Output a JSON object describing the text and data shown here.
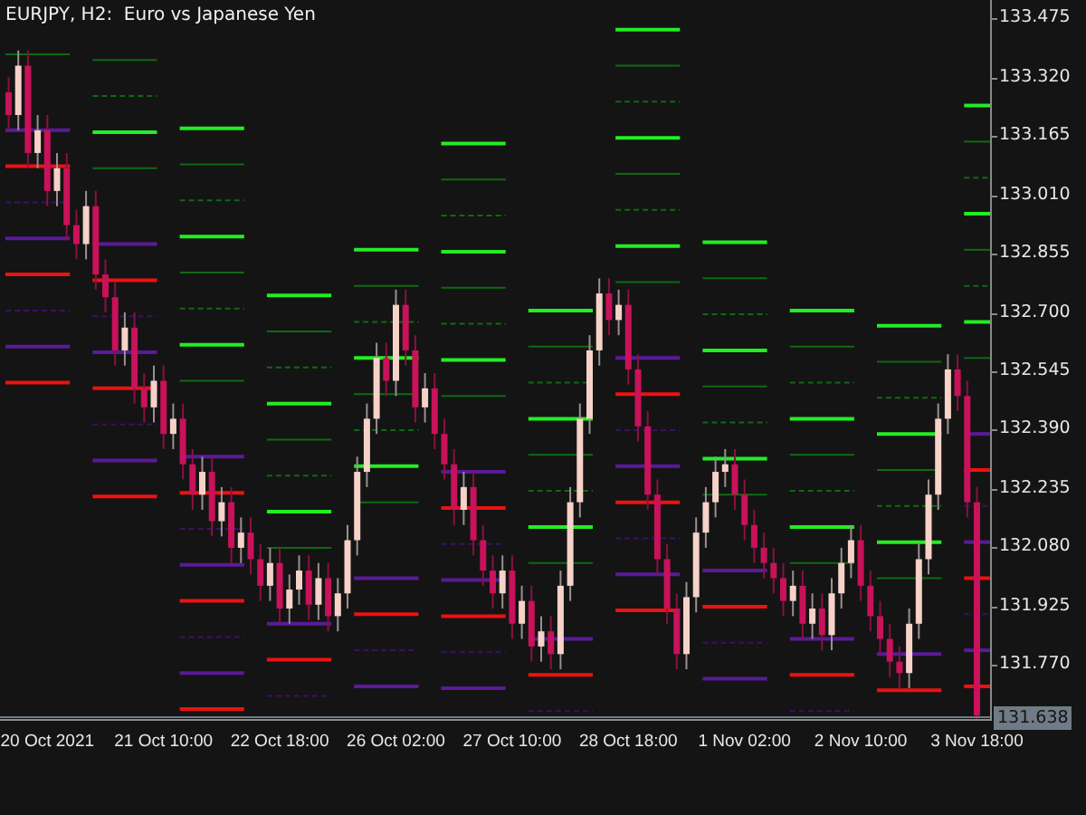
{
  "chart": {
    "title": "EURJPY, H2:  Euro vs Japanese Yen",
    "current_price": "131.638",
    "chart_data": {
      "type": "candlestick",
      "ylim": [
        131.629,
        133.523
      ],
      "yticks": [
        {
          "value": 133.475,
          "label": "133.475"
        },
        {
          "value": 133.32,
          "label": "133.320"
        },
        {
          "value": 133.165,
          "label": "133.165"
        },
        {
          "value": 133.01,
          "label": "133.010"
        },
        {
          "value": 132.855,
          "label": "132.855"
        },
        {
          "value": 132.7,
          "label": "132.700"
        },
        {
          "value": 132.545,
          "label": "132.545"
        },
        {
          "value": 132.39,
          "label": "132.390"
        },
        {
          "value": 132.235,
          "label": "132.235"
        },
        {
          "value": 132.08,
          "label": "132.080"
        },
        {
          "value": 131.925,
          "label": "131.925"
        },
        {
          "value": 131.77,
          "label": "131.770"
        }
      ],
      "categories": [
        null,
        null,
        null,
        null,
        "20 Oct 2021",
        null,
        null,
        null,
        null,
        null,
        null,
        null,
        null,
        null,
        null,
        null,
        "21 Oct 10:00",
        null,
        null,
        null,
        null,
        null,
        null,
        null,
        null,
        null,
        null,
        null,
        "22 Oct 18:00",
        null,
        null,
        null,
        null,
        null,
        null,
        null,
        null,
        null,
        null,
        null,
        "26 Oct 02:00",
        null,
        null,
        null,
        null,
        null,
        null,
        null,
        null,
        null,
        null,
        null,
        "27 Oct 10:00",
        null,
        null,
        null,
        null,
        null,
        null,
        null,
        null,
        null,
        null,
        null,
        "28 Oct 18:00",
        null,
        null,
        null,
        null,
        null,
        null,
        null,
        null,
        null,
        null,
        null,
        "1 Nov 02:00",
        null,
        null,
        null,
        null,
        null,
        null,
        null,
        null,
        null,
        null,
        null,
        "2 Nov 10:00",
        null,
        null,
        null,
        null,
        null,
        null,
        null,
        null,
        null,
        null,
        null,
        "3 Nov 18:00"
      ],
      "ohlc": [
        [
          133.28,
          133.32,
          133.18,
          133.22
        ],
        [
          133.22,
          133.39,
          133.18,
          133.35
        ],
        [
          133.35,
          133.39,
          133.08,
          133.12
        ],
        [
          133.12,
          133.22,
          133.08,
          133.18
        ],
        [
          133.18,
          133.22,
          132.98,
          133.02
        ],
        [
          133.02,
          133.12,
          132.98,
          133.08
        ],
        [
          133.08,
          133.12,
          132.89,
          132.93
        ],
        [
          132.93,
          132.97,
          132.84,
          132.88
        ],
        [
          132.88,
          133.02,
          132.84,
          132.98
        ],
        [
          132.98,
          133.02,
          132.76,
          132.8
        ],
        [
          132.8,
          132.84,
          132.7,
          132.74
        ],
        [
          132.74,
          132.78,
          132.56,
          132.6
        ],
        [
          132.6,
          132.7,
          132.56,
          132.66
        ],
        [
          132.66,
          132.7,
          132.46,
          132.5
        ],
        [
          132.5,
          132.54,
          132.41,
          132.45
        ],
        [
          132.45,
          132.56,
          132.41,
          132.52
        ],
        [
          132.52,
          132.56,
          132.34,
          132.38
        ],
        [
          132.38,
          132.46,
          132.34,
          132.42
        ],
        [
          132.42,
          132.46,
          132.26,
          132.3
        ],
        [
          132.3,
          132.34,
          132.18,
          132.22
        ],
        [
          132.22,
          132.32,
          132.18,
          132.28
        ],
        [
          132.28,
          132.32,
          132.11,
          132.15
        ],
        [
          132.15,
          132.24,
          132.11,
          132.2
        ],
        [
          132.2,
          132.24,
          132.04,
          132.08
        ],
        [
          132.08,
          132.16,
          132.04,
          132.12
        ],
        [
          132.12,
          132.16,
          132.01,
          132.05
        ],
        [
          132.05,
          132.09,
          131.94,
          131.98
        ],
        [
          131.98,
          132.08,
          131.94,
          132.04
        ],
        [
          132.04,
          132.08,
          131.88,
          131.92
        ],
        [
          131.92,
          132.01,
          131.88,
          131.97
        ],
        [
          131.97,
          132.06,
          131.93,
          132.02
        ],
        [
          132.02,
          132.06,
          131.89,
          131.93
        ],
        [
          131.93,
          132.04,
          131.89,
          132.0
        ],
        [
          132.0,
          132.04,
          131.86,
          131.9
        ],
        [
          131.9,
          132.0,
          131.86,
          131.96
        ],
        [
          131.96,
          132.14,
          131.92,
          132.1
        ],
        [
          132.1,
          132.32,
          132.06,
          132.28
        ],
        [
          132.28,
          132.46,
          132.24,
          132.42
        ],
        [
          132.42,
          132.62,
          132.38,
          132.58
        ],
        [
          132.58,
          132.62,
          132.48,
          132.52
        ],
        [
          132.52,
          132.76,
          132.48,
          132.72
        ],
        [
          132.72,
          132.76,
          132.56,
          132.6
        ],
        [
          132.6,
          132.64,
          132.41,
          132.45
        ],
        [
          132.45,
          132.54,
          132.41,
          132.5
        ],
        [
          132.5,
          132.54,
          132.34,
          132.38
        ],
        [
          132.38,
          132.42,
          132.26,
          132.3
        ],
        [
          132.3,
          132.34,
          132.14,
          132.18
        ],
        [
          132.18,
          132.28,
          132.14,
          132.24
        ],
        [
          132.24,
          132.28,
          132.06,
          132.1
        ],
        [
          132.1,
          132.14,
          131.98,
          132.02
        ],
        [
          132.02,
          132.06,
          131.92,
          131.96
        ],
        [
          131.96,
          132.06,
          131.92,
          132.02
        ],
        [
          132.02,
          132.06,
          131.84,
          131.88
        ],
        [
          131.88,
          131.98,
          131.84,
          131.94
        ],
        [
          131.94,
          131.98,
          131.78,
          131.82
        ],
        [
          131.82,
          131.9,
          131.78,
          131.86
        ],
        [
          131.86,
          131.9,
          131.76,
          131.8
        ],
        [
          131.8,
          132.02,
          131.76,
          131.98
        ],
        [
          131.98,
          132.24,
          131.94,
          132.2
        ],
        [
          132.2,
          132.46,
          132.16,
          132.42
        ],
        [
          132.42,
          132.64,
          132.38,
          132.6
        ],
        [
          132.6,
          132.79,
          132.56,
          132.75
        ],
        [
          132.75,
          132.79,
          132.64,
          132.68
        ],
        [
          132.68,
          132.76,
          132.64,
          132.72
        ],
        [
          132.72,
          132.76,
          132.51,
          132.55
        ],
        [
          132.55,
          132.59,
          132.36,
          132.4
        ],
        [
          132.4,
          132.44,
          132.18,
          132.22
        ],
        [
          132.22,
          132.26,
          132.01,
          132.05
        ],
        [
          132.05,
          132.09,
          131.88,
          131.92
        ],
        [
          131.92,
          131.96,
          131.76,
          131.8
        ],
        [
          131.8,
          131.99,
          131.76,
          131.95
        ],
        [
          131.95,
          132.16,
          131.91,
          132.12
        ],
        [
          132.12,
          132.24,
          132.08,
          132.2
        ],
        [
          132.2,
          132.32,
          132.16,
          132.28
        ],
        [
          132.28,
          132.34,
          132.24,
          132.3
        ],
        [
          132.3,
          132.34,
          132.18,
          132.22
        ],
        [
          132.22,
          132.26,
          132.1,
          132.14
        ],
        [
          132.14,
          132.18,
          132.04,
          132.08
        ],
        [
          132.08,
          132.12,
          132.0,
          132.04
        ],
        [
          132.04,
          132.08,
          131.96,
          132.0
        ],
        [
          132.0,
          132.04,
          131.9,
          131.94
        ],
        [
          131.94,
          132.02,
          131.9,
          131.98
        ],
        [
          131.98,
          132.02,
          131.84,
          131.88
        ],
        [
          131.88,
          131.96,
          131.84,
          131.92
        ],
        [
          131.92,
          131.96,
          131.81,
          131.85
        ],
        [
          131.85,
          132.0,
          131.81,
          131.96
        ],
        [
          131.96,
          132.08,
          131.92,
          132.04
        ],
        [
          132.04,
          132.14,
          132.0,
          132.1
        ],
        [
          132.1,
          132.14,
          131.94,
          131.98
        ],
        [
          131.98,
          132.02,
          131.86,
          131.9
        ],
        [
          131.9,
          131.94,
          131.8,
          131.84
        ],
        [
          131.84,
          131.88,
          131.74,
          131.78
        ],
        [
          131.78,
          131.82,
          131.71,
          131.75
        ],
        [
          131.75,
          131.92,
          131.71,
          131.88
        ],
        [
          131.88,
          132.09,
          131.84,
          132.05
        ],
        [
          132.05,
          132.26,
          132.01,
          132.22
        ],
        [
          132.22,
          132.46,
          132.18,
          132.42
        ],
        [
          132.42,
          132.59,
          132.38,
          132.55
        ],
        [
          132.55,
          132.59,
          132.44,
          132.48
        ],
        [
          132.48,
          132.52,
          132.16,
          132.2
        ],
        [
          132.2,
          132.24,
          131.62,
          131.638
        ]
      ]
    }
  }
}
